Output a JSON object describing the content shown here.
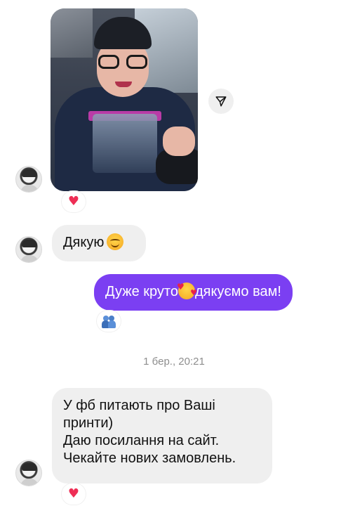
{
  "thread": {
    "messages": [
      {
        "from": "them",
        "type": "photo",
        "reaction": "heart"
      },
      {
        "from": "them",
        "type": "text",
        "text": "Дякую",
        "emoji": "smiling-face"
      },
      {
        "from": "me",
        "type": "text",
        "text_before": "Дуже круто",
        "emoji": "smiling-face-with-hearts",
        "text_after": "дякуємо вам!",
        "reaction": "people"
      },
      {
        "from": "them",
        "type": "text",
        "lines": [
          "У фб питають про Ваші",
          "принти)",
          "Даю посилання на сайт.",
          "Чекайте нових замовлень."
        ],
        "reaction": "heart"
      }
    ],
    "timestamp": "1 бер., 20:21"
  },
  "colors": {
    "outgoing_bubble": "#7b3ff2",
    "incoming_bubble": "#efefef",
    "heart": "#ee2e55",
    "timestamp": "#8e8e8e"
  },
  "icons": {
    "share": "paper-plane-icon",
    "reaction_heart": "heart-icon",
    "reaction_people": "people-hugging-icon"
  }
}
